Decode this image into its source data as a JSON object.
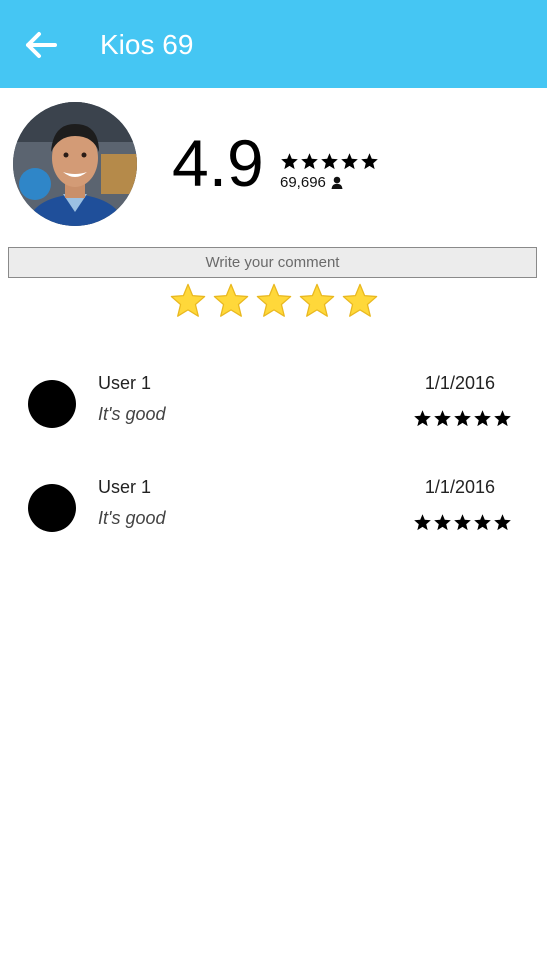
{
  "appbar": {
    "title": "Kios 69",
    "back_icon": "arrow-left-icon",
    "background": "#45c6f3"
  },
  "summary": {
    "rating": "4.9",
    "stars_filled": 5,
    "reviewer_count": "69,696",
    "count_icon": "person-icon",
    "avatar_icon": "profile-photo"
  },
  "comment": {
    "placeholder": "Write your comment"
  },
  "rate_input": {
    "stars_max": 5,
    "star_color": "#ffd83a"
  },
  "reviews": [
    {
      "user": "User 1",
      "comment": "It's good",
      "date": "1/1/2016",
      "stars": 5
    },
    {
      "user": "User 1",
      "comment": "It's good",
      "date": "1/1/2016",
      "stars": 5
    }
  ]
}
